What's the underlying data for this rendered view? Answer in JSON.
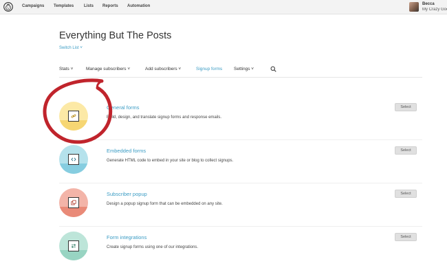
{
  "nav": {
    "items": [
      "Campaigns",
      "Templates",
      "Lists",
      "Reports",
      "Automation"
    ]
  },
  "user": {
    "name": "Becca",
    "account": "My Crazy Goo"
  },
  "page": {
    "title": "Everything But The Posts",
    "switch_list": "Switch List ˅"
  },
  "subnav": {
    "items": [
      "Stats ˅",
      "Manage subscribers ˅",
      "Add subscribers ˅",
      "Signup forms",
      "Settings ˅"
    ],
    "active": "Signup forms",
    "search_icon": "search-icon"
  },
  "forms": [
    {
      "title": "General forms",
      "description": "Build, design, and translate signup forms and response emails.",
      "button": "Select",
      "icon": "link-icon",
      "color_light": "#fce9a6",
      "color_dark": "#f6d673"
    },
    {
      "title": "Embedded forms",
      "description": "Generate HTML code to embed in your site or blog to collect signups.",
      "button": "Select",
      "icon": "code-icon",
      "color_light": "#b5e2ec",
      "color_dark": "#86cde0"
    },
    {
      "title": "Subscriber popup",
      "description": "Design a popup signup form that can be embedded on any site.",
      "button": "Select",
      "icon": "popup-icon",
      "color_light": "#f3b4a8",
      "color_dark": "#e98a78"
    },
    {
      "title": "Form integrations",
      "description": "Create signup forms using one of our integrations.",
      "button": "Select",
      "icon": "integration-arrows-icon",
      "color_light": "#bde5d9",
      "color_dark": "#98d4c2"
    }
  ],
  "colors": {
    "accent": "#3b9cc4",
    "highlight_ring": "#c0242c"
  }
}
